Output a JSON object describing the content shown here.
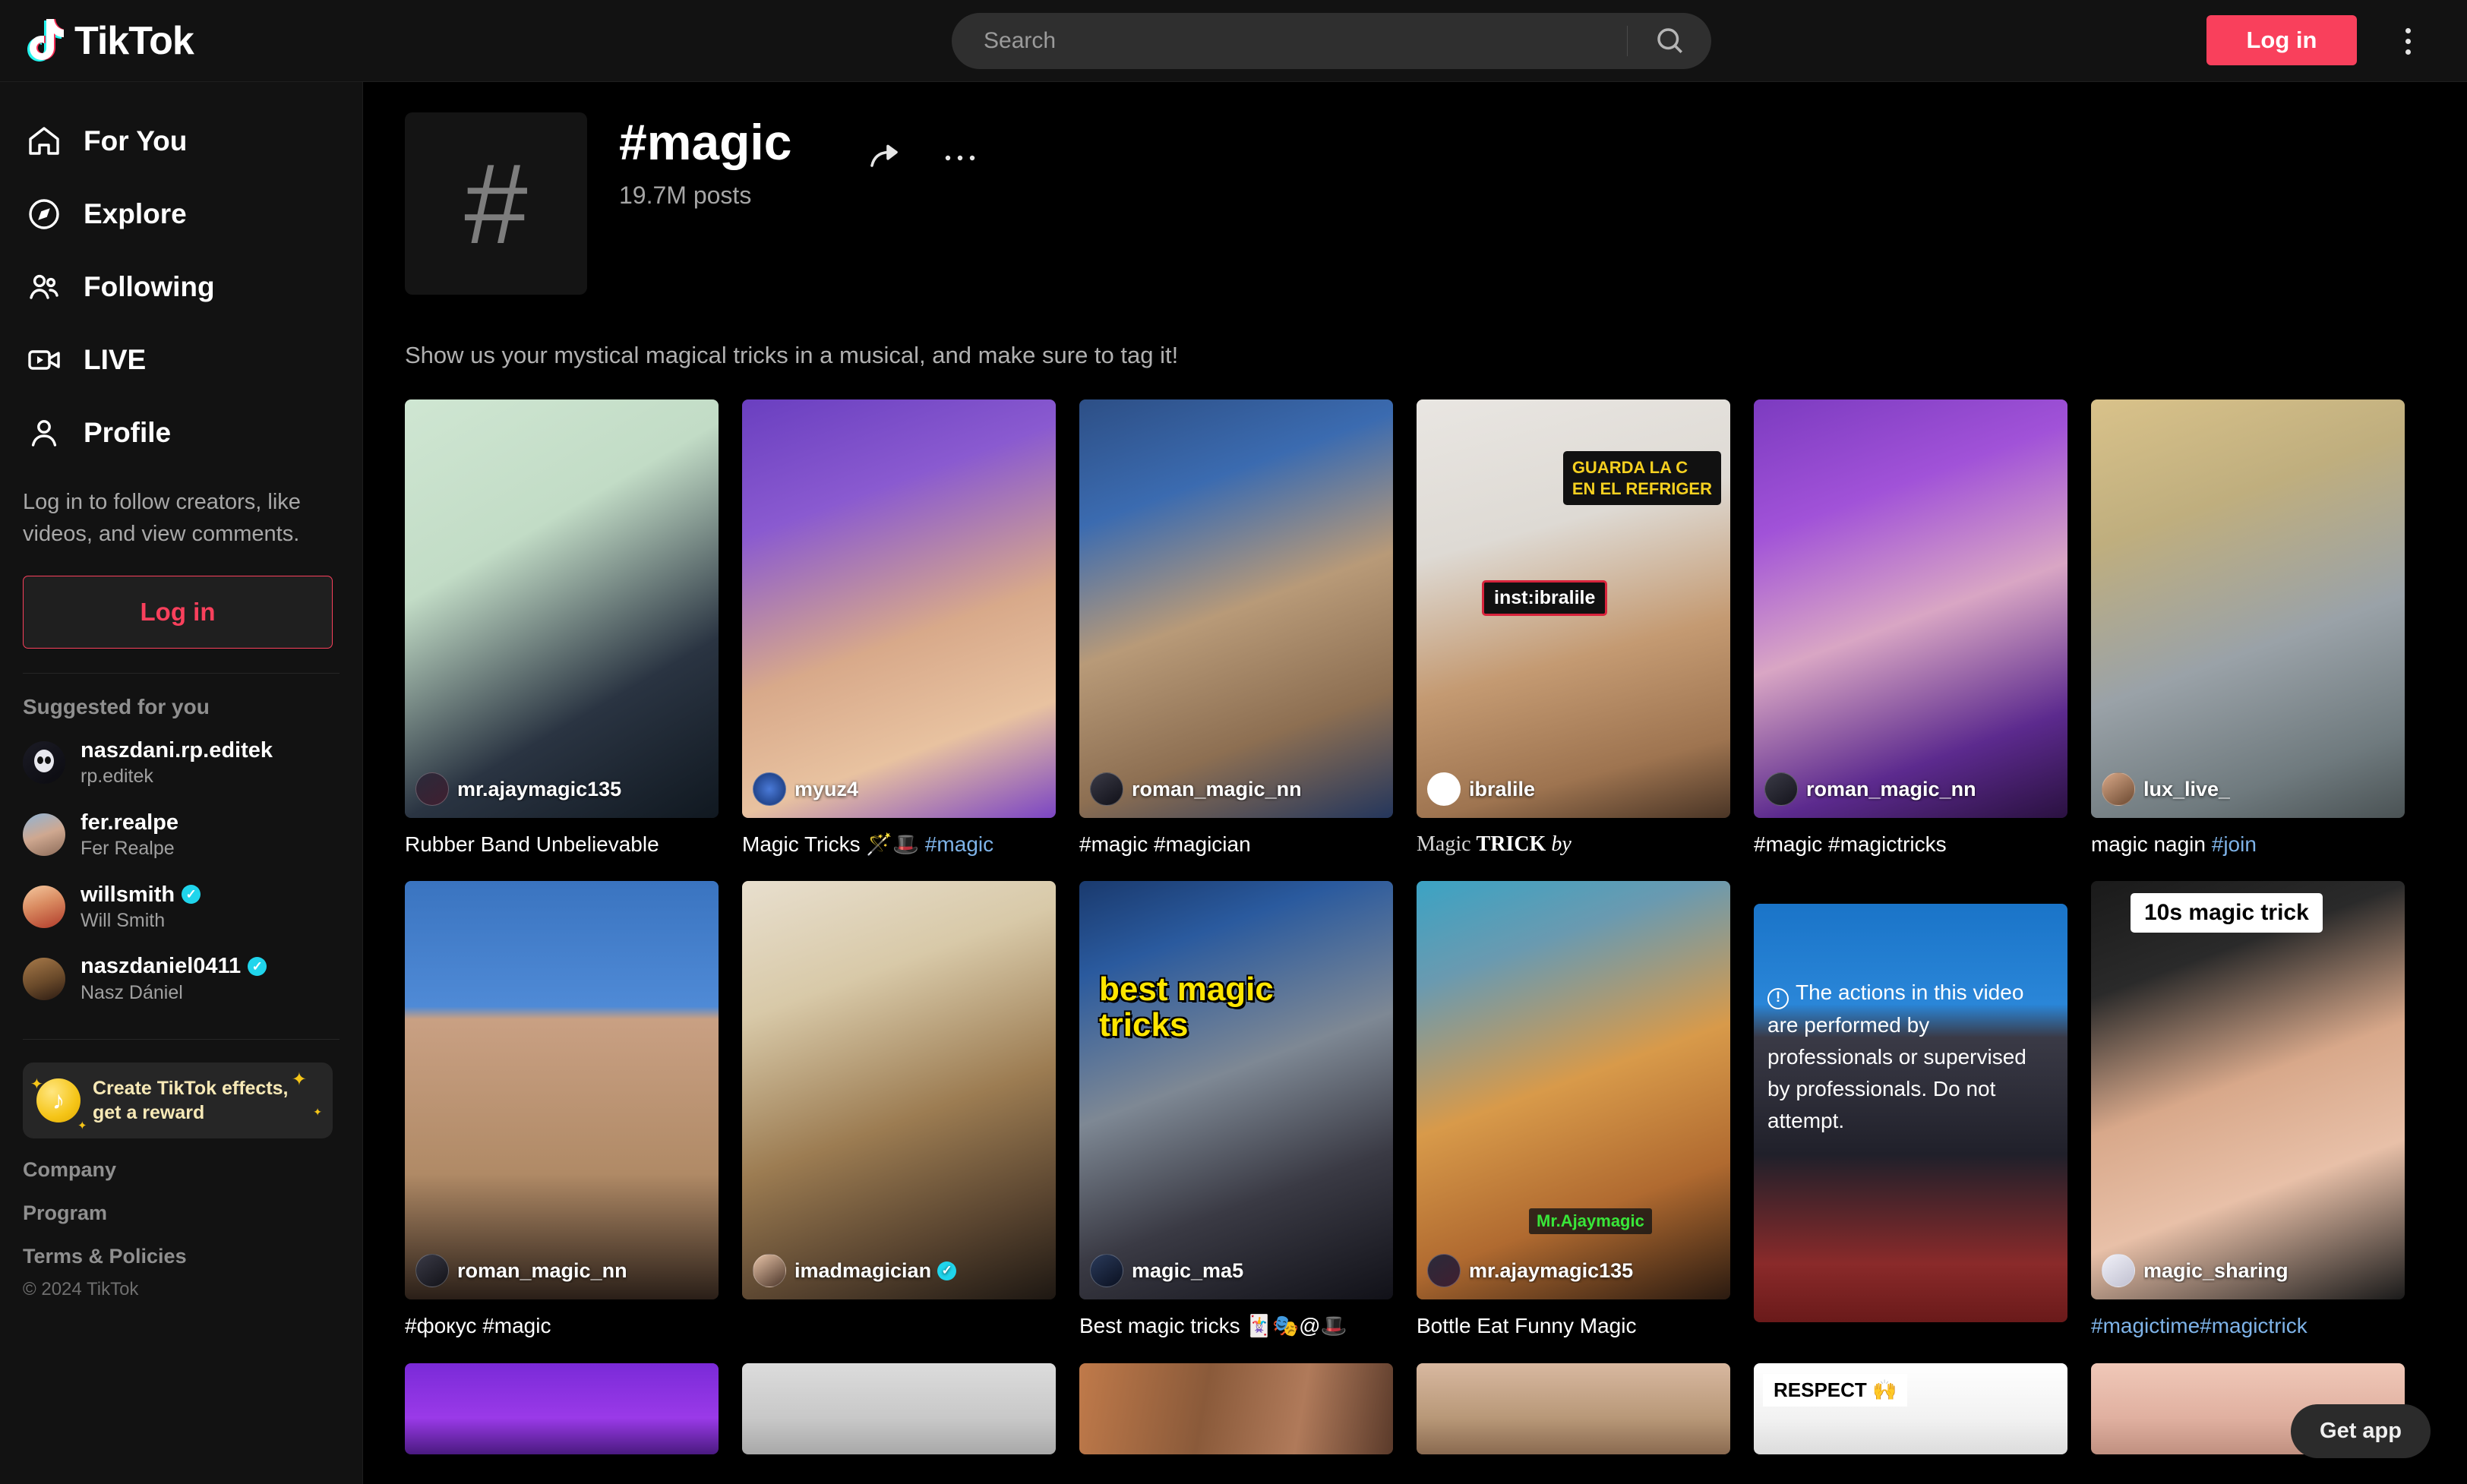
{
  "header": {
    "logo_text": "TikTok",
    "logo_icon": "tiktok-note-icon",
    "search_placeholder": "Search",
    "search_value": "",
    "search_icon": "search-icon",
    "login_label": "Log in",
    "more_icon": "more-vertical-icon"
  },
  "sidebar": {
    "nav": [
      {
        "label": "For You",
        "icon": "home-icon"
      },
      {
        "label": "Explore",
        "icon": "compass-icon"
      },
      {
        "label": "Following",
        "icon": "users-icon"
      },
      {
        "label": "LIVE",
        "icon": "video-camera-icon"
      },
      {
        "label": "Profile",
        "icon": "person-icon"
      }
    ],
    "login_prompt": "Log in to follow creators, like videos, and view comments.",
    "login_label": "Log in",
    "suggested_title": "Suggested for you",
    "suggested": [
      {
        "user": "naszdani.rp.editek",
        "name": "rp.editek",
        "verified": false,
        "avatar_colors": [
          "#1b1b25",
          "#0b0b10"
        ]
      },
      {
        "user": "fer.realpe",
        "name": "Fer Realpe",
        "verified": false,
        "avatar_colors": [
          "#8fb4d6",
          "#c99a86"
        ]
      },
      {
        "user": "willsmith",
        "name": "Will Smith",
        "verified": true,
        "avatar_colors": [
          "#f0a878",
          "#c2503a"
        ]
      },
      {
        "user": "naszdaniel0411",
        "name": "Nasz Dániel",
        "verified": true,
        "avatar_colors": [
          "#9b6a3e",
          "#3a2a1c"
        ]
      }
    ],
    "promo": {
      "text": "Create TikTok effects, get a reward",
      "icon": "tiktok-coin-icon"
    },
    "footer_links": [
      "Company",
      "Program",
      "Terms & Policies"
    ],
    "copyright": "© 2024 TikTok"
  },
  "hashtag": {
    "avatar_icon": "hashtag-icon",
    "title": "#magic",
    "posts": "19.7M posts",
    "share_icon": "share-arrow-icon",
    "more_icon": "more-horizontal-icon",
    "description": "Show us your mystical magical tricks in a musical, and make sure to tag it!"
  },
  "videos": [
    {
      "user": "mr.ajaymagic135",
      "caption": "Rubber Band Unbelievable",
      "caption_tag": "",
      "verified": false,
      "bg": "linear-gradient(150deg,#cfe6d2 0%,#bcd9c2 38%,#1e2a38 75%,#0d1620 100%)",
      "avatar_colors": [
        "#1a1a2a",
        "#402030"
      ]
    },
    {
      "user": "myuz4",
      "caption": "Magic Tricks 🪄🎩 ",
      "caption_tag": "#magic",
      "verified": false,
      "bg": "linear-gradient(160deg,#6a3fc0 0%,#8a5ad0 30%,#d8a98a 58%,#e8c2a0 80%,#7b45c4 100%)",
      "avatar_colors": [
        "#2b4f9e",
        "#12306e"
      ]
    },
    {
      "user": "roman_magic_nn",
      "caption": "#magic #magician",
      "caption_all_tag": false,
      "verified": false,
      "bg": "linear-gradient(160deg,#2d4f86 0%,#3b6bb0 26%,#b89a78 52%,#8d6f52 78%,#24365c 100%)",
      "avatar_colors": [
        "#30303c",
        "#101018"
      ]
    },
    {
      "user": "ibralile",
      "caption": "Magic TRICK by",
      "verified": false,
      "styled_caption": true,
      "bg": "linear-gradient(165deg,#e9e6e2 0%,#dedad4 34%,#c49a72 62%,#9e7450 85%,#4a3526 100%)",
      "avatar_colors": [
        "#ffffff",
        "#cfcfcf"
      ],
      "overlay_label": "GUARDA LA C EN EL REFRIGER",
      "overlay_insta": "inst:ibralile"
    },
    {
      "user": "roman_magic_nn",
      "caption": "#magic #magictricks",
      "verified": false,
      "bg": "linear-gradient(160deg,#7c3bc0 0%,#a152d8 28%,#d9a6c4 55%,#5c2a8e 80%,#2a1140 100%)",
      "avatar_colors": [
        "#33333f",
        "#14141c"
      ]
    },
    {
      "user": "lux_live_",
      "caption": "magic nagin ",
      "caption_tag": "#join",
      "verified": false,
      "bg": "linear-gradient(160deg,#d9c28a 0%,#c8b municipality 0%,#bfae7e 30%,#9aa2a8 60%,#6f7a7e 85%,#4a5254 100%)",
      "avatar_colors": [
        "#c09a76",
        "#6a4830"
      ]
    },
    {
      "user": "roman_magic_nn",
      "caption": "#фокус #magic",
      "verified": false,
      "bg": "linear-gradient(160deg,#2f6fc4 0%,#4f8ad6 22%,#c9a083 55%,#8c6a4a 82%,#2a1f18 100%)",
      "avatar_colors": [
        "#2e2e3a",
        "#121218"
      ],
      "split_top": "#2f6fc4"
    },
    {
      "user": "imadmagician",
      "caption": "",
      "verified": true,
      "bg": "linear-gradient(160deg,#e8dfce 0%,#d8c9a8 28%,#9c7c52 58%,#5a4530 82%,#1d1712 100%)",
      "avatar_colors": [
        "#d8b79a",
        "#4a3428"
      ]
    },
    {
      "user": "magic_ma5",
      "caption": "Best magic tricks 🃏🎭@🎩",
      "verified": false,
      "bg": "linear-gradient(160deg,#1a3a6e 0%,#2a5a9e 20%,#7e8894 48%,#3a3a44 74%,#111118 100%)",
      "avatar_colors": [
        "#1a2a4a",
        "#0a1020"
      ],
      "overlay_yellow": "best magic tricks"
    },
    {
      "user": "mr.ajaymagic135",
      "caption": "Bottle Eat Funny Magic",
      "verified": false,
      "bg": "linear-gradient(160deg,#3ba3c4 0%,#6a9ab0 22%,#d89a4a 50%,#b06a30 76%,#2a1a10 100%)",
      "avatar_colors": [
        "#1a1a2a",
        "#402030"
      ],
      "overlay_green": "Mr.Ajaymagic"
    },
    {
      "user": "",
      "caption": "",
      "verified": false,
      "bg": "linear-gradient(180deg,#1a74c8 0%,#2a86d8 26%,#3a3a46 34%,#20202a 62%,#8a2a2a 88%,#6a1a1a 100%)",
      "warning": "The actions in this video are performed by professionals or supervised by professionals. Do not attempt.",
      "warning_icon": "warning-circle-icon"
    },
    {
      "user": "magic_sharing",
      "caption": "#magictime#magictrick",
      "caption_all_tag": true,
      "verified": false,
      "bg": "linear-gradient(160deg,#1a1a1a 0%,#2a2a2a 24%,#d8a88a 50%,#e8c0a8 72%,#1a1a1a 100%)",
      "avatar_colors": [
        "#e8e8f0",
        "#c0c0d0"
      ],
      "overlay_label": "10s magic trick"
    }
  ],
  "videos_row3": [
    {
      "bg": "linear-gradient(180deg,#7a2ad8 0%,#9a3ae8 60%,#4a1a80 100%)"
    },
    {
      "bg": "linear-gradient(180deg,#d8d8d8 0%,#c8c8c8 60%,#a8a8a8 100%)"
    },
    {
      "bg": "linear-gradient(180deg,#c07a4a 0%,#8a5a3a 50%,#5a3a2a 100%)"
    },
    {
      "bg": "linear-gradient(180deg,#d8b8a0 0%,#b89878 60%,#8a6a50 100%)"
    },
    {
      "bg": "linear-gradient(180deg,#ffffff 0%,#f0f0f0 60%,#d8d8d8 100%)",
      "overlay_respect": "RESPECT 🙌"
    },
    {
      "bg": "linear-gradient(180deg,#f0c8b8 0%,#e0b0a0 60%,#c09080 100%)"
    }
  ],
  "get_app_label": "Get app"
}
